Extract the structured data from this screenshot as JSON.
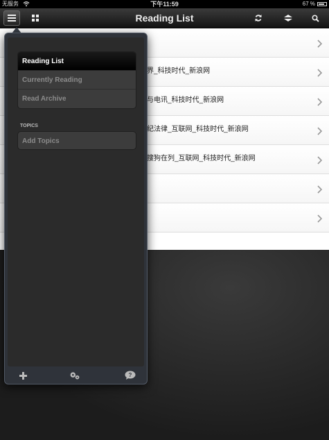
{
  "status_bar": {
    "carrier": "无服务",
    "time": "下午11:59",
    "battery": "67 %"
  },
  "nav_bar": {
    "title": "Reading List"
  },
  "list": {
    "rows": [
      {
        "title": ""
      },
      {
        "title": "界_科技时代_新浪网"
      },
      {
        "title": "与电讯_科技时代_新浪网"
      },
      {
        "title": "纪法律_互联网_科技时代_新浪网"
      },
      {
        "title": "搜狗在列_互联网_科技时代_新浪网"
      },
      {
        "title": ""
      },
      {
        "title": ""
      },
      {
        "title": ""
      }
    ]
  },
  "sidebar": {
    "items": [
      {
        "label": "Reading List"
      },
      {
        "label": "Currently Reading"
      },
      {
        "label": "Read Archive"
      }
    ],
    "topics_header": "TOPICS",
    "add_topics": "Add Topics"
  },
  "icons": {
    "menu": "menu-icon",
    "grid": "grid-icon",
    "refresh": "refresh-icon",
    "sort": "sort-icon",
    "search": "search-icon",
    "add": "plus-icon",
    "settings": "gears-icon",
    "help": "help-bubble-icon",
    "chevron": "chevron-right-icon"
  }
}
